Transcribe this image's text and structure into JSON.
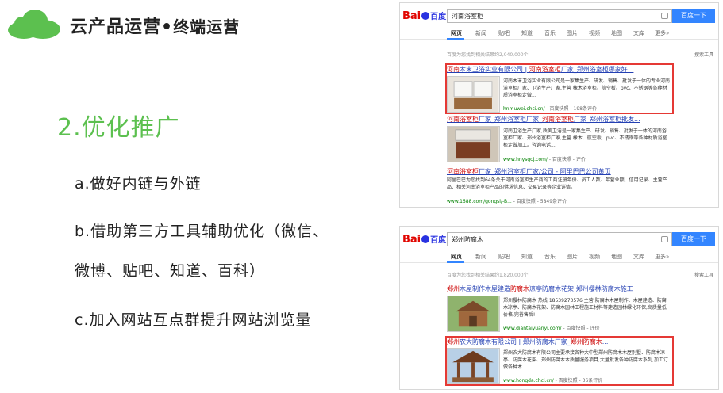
{
  "header": {
    "title_main": "云产品运营",
    "title_dot": "•",
    "title_sub": "终端运营"
  },
  "section_title": "2.优化推广",
  "bullets": [
    "a.做好内链与外链",
    "b.借助第三方工具辅助优化（微信、",
    "微博、贴吧、知道、百科）",
    "c.加入网站互点群提升网站浏览量"
  ],
  "colors": {
    "accent_green": "#5cc04f",
    "highlight_red": "#e53935",
    "baidu_blue": "#3385ff"
  },
  "search_tabs": [
    "网页",
    "新闻",
    "贴吧",
    "知道",
    "音乐",
    "图片",
    "视频",
    "地图",
    "文库",
    "更多»"
  ],
  "panel1": {
    "query": "河南浴室柜",
    "button": "百度一下",
    "count": "百度为您找到相关结果约2,040,000个",
    "tool": "搜索工具",
    "results": [
      {
        "title_pre": "河南",
        "title_mid": "木末卫浴实业有限公司 | ",
        "title_hl": "河南浴室柜",
        "title_post": "厂家_郑州浴室柜哪家好...",
        "body": "河南木末卫浴实业有限公司是一家集生产、研发、销售、批发于一体的专业河南浴室柜厂家、卫浴生产厂家,主营 橡木浴室柜、航空板、pvc、不锈钢等各种材质浴室柜定做...",
        "url": "hnmuwei.chci.cn/",
        "url_extra": "- 百度快照 - 198条评价"
      },
      {
        "title_pre": "河南浴室柜",
        "title_mid": "厂家_郑州浴室柜厂家_",
        "title_hl": "河南浴室柜",
        "title_post": "厂家_郑州浴室柜批发...",
        "body": "河南卫浴生产厂家,质美卫浴是一家集生产、研发、销售、批发于一体的河南浴室柜厂家、郑州浴室柜厂家,主营 橡木、航空板、pvc、不锈钢等各种材质浴室柜定做加工。咨询电话...",
        "url": "www.hnysgcj.com/",
        "url_extra": "- 百度快照 - 评价"
      },
      {
        "title_pre": "河南浴室柜",
        "title_mid": "厂家_郑州浴室柜厂家/公司 - 阿里巴巴公司黄页",
        "title_hl": "",
        "title_post": "",
        "body": "阿里巴巴为您找到64条关于河南浴室柜生产商的工商注册年份、员工人数、年营业额、信用记录、主营产品、相关河南浴室柜产品的供求信息、交易记录等企业详情。",
        "url": "www.1688.com/gongsi/-B...",
        "url_extra": "- 百度快照 - 5849条评价"
      }
    ]
  },
  "panel2": {
    "query": "郑州防腐木",
    "button": "百度一下",
    "count": "百度为您找到相关结果约1,820,000个",
    "tool": "搜索工具",
    "results": [
      {
        "title_pre": "郑州",
        "title_mid": "木屋制作木屋建造",
        "title_hl": "防腐木",
        "title_post": "凉亭防腐木花架|郑州樱林防腐木施工",
        "body": "郑州樱林防腐木 热线 18539273576 主营:防腐木木屋制作、木屋建造、防腐木凉亭、防腐木花架、防腐木园林工程施工材料等建造园林绿化环保,高质量低价格,完善售后!",
        "url": "www.diantaiyuanyi.com/",
        "url_extra": "- 百度快照 - 评价"
      },
      {
        "title_pre": "郑州",
        "title_mid": "农大防腐木有限公司 | 郑州防腐木厂家_",
        "title_hl": "郑州防腐木",
        "title_post": "...",
        "body": "郑州农大防腐木有限公司主要承接各种大中型郑州防腐木木屋别墅、防腐木凉亭、防腐木花架、郑州防腐木木质量服务项目,大量批发各种防腐木系列,加工订做各种木...",
        "url": "www.hongda.chci.cn/",
        "url_extra": "- 百度快照 - 36条评价"
      }
    ]
  }
}
